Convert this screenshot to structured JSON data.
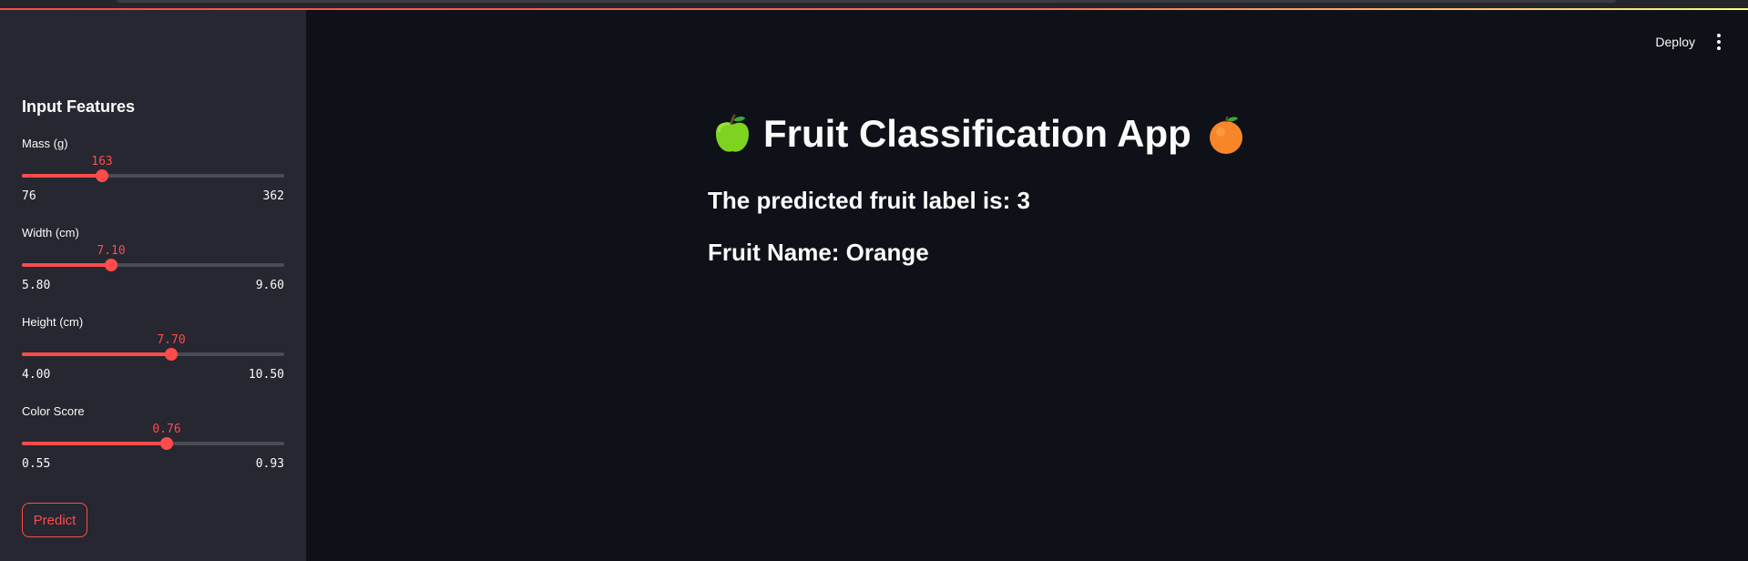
{
  "header": {
    "deploy_label": "Deploy",
    "menu_icon": "more-vertical-icon"
  },
  "sidebar": {
    "title": "Input Features",
    "sliders": [
      {
        "label": "Mass (g)",
        "value": "163",
        "min": "76",
        "max": "362",
        "fraction": 0.304
      },
      {
        "label": "Width (cm)",
        "value": "7.10",
        "min": "5.80",
        "max": "9.60",
        "fraction": 0.342
      },
      {
        "label": "Height (cm)",
        "value": "7.70",
        "min": "4.00",
        "max": "10.50",
        "fraction": 0.569
      },
      {
        "label": "Color Score",
        "value": "0.76",
        "min": "0.55",
        "max": "0.93",
        "fraction": 0.553
      }
    ],
    "predict_label": "Predict"
  },
  "main": {
    "title": "Fruit Classification App",
    "title_icons": [
      "green-apple-icon",
      "orange-icon"
    ],
    "prediction_text": "The predicted fruit label is: 3",
    "fruit_name_text": "Fruit Name: Orange"
  },
  "colors": {
    "accent": "#ff4b4b",
    "background": "#0e1117",
    "sidebar": "#262730",
    "text": "#fafafa"
  }
}
